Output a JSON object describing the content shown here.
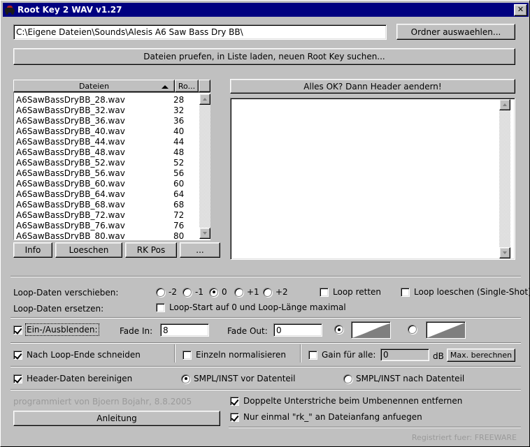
{
  "window": {
    "title": "Root Key 2 WAV v1.27",
    "icon": "car-icon",
    "close_label": "✕"
  },
  "path": {
    "value": "C:\\Eigene Dateien\\Sounds\\Alesis A6 Saw Bass Dry BB\\",
    "browse_button": "Ordner auswaehlen..."
  },
  "scan_button": "Dateien pruefen, in Liste laden, neuen Root Key suchen...",
  "filelist": {
    "columns": [
      "Dateien",
      "Ro..."
    ],
    "sort_indicator": "ascending",
    "rows": [
      {
        "file": "A6SawBassDryBB_28.wav",
        "rootkey": "28"
      },
      {
        "file": "A6SawBassDryBB_32.wav",
        "rootkey": "32"
      },
      {
        "file": "A6SawBassDryBB_36.wav",
        "rootkey": "36"
      },
      {
        "file": "A6SawBassDryBB_40.wav",
        "rootkey": "40"
      },
      {
        "file": "A6SawBassDryBB_44.wav",
        "rootkey": "44"
      },
      {
        "file": "A6SawBassDryBB_48.wav",
        "rootkey": "48"
      },
      {
        "file": "A6SawBassDryBB_52.wav",
        "rootkey": "52"
      },
      {
        "file": "A6SawBassDryBB_56.wav",
        "rootkey": "56"
      },
      {
        "file": "A6SawBassDryBB_60.wav",
        "rootkey": "60"
      },
      {
        "file": "A6SawBassDryBB_64.wav",
        "rootkey": "64"
      },
      {
        "file": "A6SawBassDryBB_68.wav",
        "rootkey": "68"
      },
      {
        "file": "A6SawBassDryBB_72.wav",
        "rootkey": "72"
      },
      {
        "file": "A6SawBassDryBB_76.wav",
        "rootkey": "76"
      },
      {
        "file": "A6SawBassDryBB_80.wav",
        "rootkey": "80"
      }
    ]
  },
  "list_buttons": {
    "info": "Info",
    "delete": "Loeschen",
    "rkpos": "RK Pos",
    "more": "..."
  },
  "apply_button": "Alles OK? Dann Header aendern!",
  "log": {
    "value": ""
  },
  "loop": {
    "shift_label": "Loop-Daten verschieben:",
    "shift_options": [
      "-2",
      "-1",
      "0",
      "+1",
      "+2"
    ],
    "shift_selected": "0",
    "replace_label": "Loop-Daten ersetzen:",
    "replace_checkbox": "Loop-Start auf 0 und Loop-Länge maximal",
    "replace_checked": false,
    "save_loop": "Loop retten",
    "save_loop_checked": false,
    "delete_loop": "Loop loeschen (Single-Shot)",
    "delete_loop_checked": false
  },
  "fade": {
    "enable_label": "Ein-/Ausblenden:",
    "enable_checked": true,
    "fade_in_label": "Fade In:",
    "fade_in_value": "8",
    "fade_out_label": "Fade Out:",
    "fade_out_value": "0",
    "curve_exponential_selected": true,
    "curve_linear_selected": false,
    "curve_exponential_name": "exponential-fade-curve",
    "curve_linear_name": "linear-fade-curve"
  },
  "cut": {
    "label": "Nach Loop-Ende schneiden",
    "checked": true
  },
  "normalize": {
    "label": "Einzeln normalisieren",
    "checked": false
  },
  "gain": {
    "label": "Gain für alle:",
    "checked": false,
    "value": "0",
    "unit": "dB",
    "max_button": "Max. berechnen"
  },
  "header": {
    "clean_label": "Header-Daten bereinigen",
    "clean_checked": true,
    "before_label": "SMPL/INST vor Datenteil",
    "after_label": "SMPL/INST nach Datenteil",
    "position_selected": "before"
  },
  "footer": {
    "credit": "programmiert von Bjoern Bojahr, 8.8.2005",
    "manual_button": "Anleitung",
    "double_underscore_label": "Doppelte Unterstriche beim Umbenennen entfernen",
    "double_underscore_checked": true,
    "prefix_label": "Nur einmal \"rk_\" an Dateianfang anfuegen",
    "prefix_checked": true,
    "registered": "Registriert fuer: FREEWARE"
  },
  "colors": {
    "titlebar": "#000080",
    "face": "#c0c0c0",
    "field": "#ffffff",
    "disabled_text": "#9a9a9a"
  }
}
